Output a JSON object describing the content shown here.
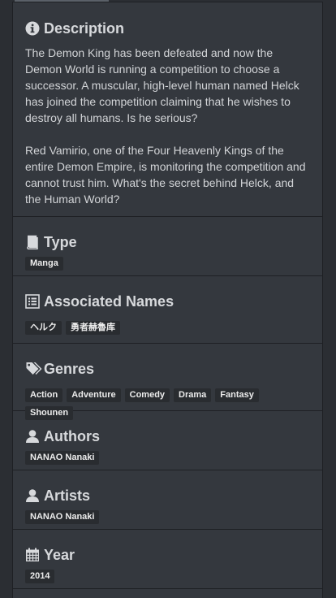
{
  "description": {
    "heading": "Description",
    "icon": "info-circle-icon",
    "paragraphs": [
      "The Demon King has been defeated and now the Demon World is running a competition to choose a successor. A muscular, high-level human named Helck has joined the competition claiming that he wishes to destroy all humans. Is he serious?",
      "Red Vamirio, one of the Four Heavenly Kings of the entire Demon Empire, is monitoring the competition and cannot trust him. What's the secret behind Helck, and the Human World?"
    ]
  },
  "type": {
    "heading": "Type",
    "icon": "book-icon",
    "tags": [
      "Manga"
    ]
  },
  "associated_names": {
    "heading": "Associated Names",
    "icon": "list-icon",
    "tags": [
      "ヘルク",
      "勇者赫魯库"
    ]
  },
  "genres": {
    "heading": "Genres",
    "icon": "tags-icon",
    "tags": [
      "Action",
      "Adventure",
      "Comedy",
      "Drama",
      "Fantasy",
      "Shounen"
    ]
  },
  "authors": {
    "heading": "Authors",
    "icon": "user-icon",
    "tags": [
      "NANAO Nanaki"
    ]
  },
  "artists": {
    "heading": "Artists",
    "icon": "user-icon",
    "tags": [
      "NANAO Nanaki"
    ]
  },
  "year": {
    "heading": "Year",
    "icon": "calendar-icon",
    "tags": [
      "2014"
    ]
  },
  "colors": {
    "background": "#2b2e33",
    "panel": "#34383e",
    "tag_background": "#292c30",
    "text": "#d2d4d7"
  }
}
